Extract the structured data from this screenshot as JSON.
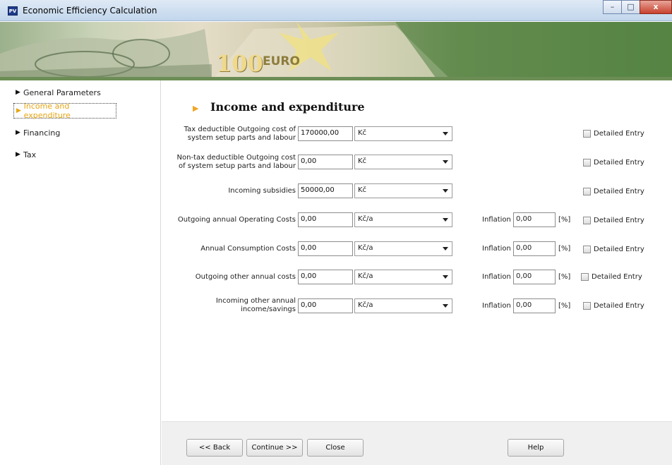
{
  "window": {
    "title": "Economic Efficiency Calculation",
    "app_icon_text": "PV",
    "controls": {
      "minimize": "–",
      "maximize": "□",
      "close": "x"
    }
  },
  "banner": {
    "euro_amount": "100",
    "euro_text": "EURO"
  },
  "nav": [
    {
      "label": "General Parameters",
      "active": false
    },
    {
      "label": "Income and expenditure",
      "active": true
    },
    {
      "label": "Financing",
      "active": false
    },
    {
      "label": "Tax",
      "active": false
    }
  ],
  "section": {
    "title": "Income and expenditure"
  },
  "rows": [
    {
      "label_lines": [
        "Tax deductible Outgoing cost of",
        "system setup parts and labour"
      ],
      "value": "170000,00",
      "unit": "Kč",
      "inflation": null,
      "detailed_label": "Detailed Entry"
    },
    {
      "label_lines": [
        "Non-tax deductible Outgoing cost",
        "of system setup parts and labour"
      ],
      "value": "0,00",
      "unit": "Kč",
      "inflation": null,
      "detailed_label": "Detailed Entry"
    },
    {
      "label_lines": [
        "Incoming subsidies"
      ],
      "value": "50000,00",
      "unit": "Kč",
      "inflation": null,
      "detailed_label": "Detailed Entry"
    },
    {
      "label_lines": [
        "Outgoing annual Operating Costs"
      ],
      "value": "0,00",
      "unit": "Kč/a",
      "inflation": "0,00",
      "detailed_label": "Detailed Entry"
    },
    {
      "label_lines": [
        "Annual Consumption Costs"
      ],
      "value": "0,00",
      "unit": "Kč/a",
      "inflation": "0,00",
      "detailed_label": "Detailed Entry"
    },
    {
      "label_lines": [
        "Outgoing other annual costs"
      ],
      "value": "0,00",
      "unit": "Kč/a",
      "inflation": "0,00",
      "detailed_label": "Detailed Entry"
    },
    {
      "label_lines": [
        "Incoming other annual",
        "income/savings"
      ],
      "value": "0,00",
      "unit": "Kč/a",
      "inflation": "0,00",
      "detailed_label": "Detailed Entry"
    }
  ],
  "inflation_label": "Inflation",
  "percent_unit": "[%]",
  "buttons": {
    "back": "<< Back",
    "continue": "Continue >>",
    "close": "Close",
    "help": "Help"
  }
}
